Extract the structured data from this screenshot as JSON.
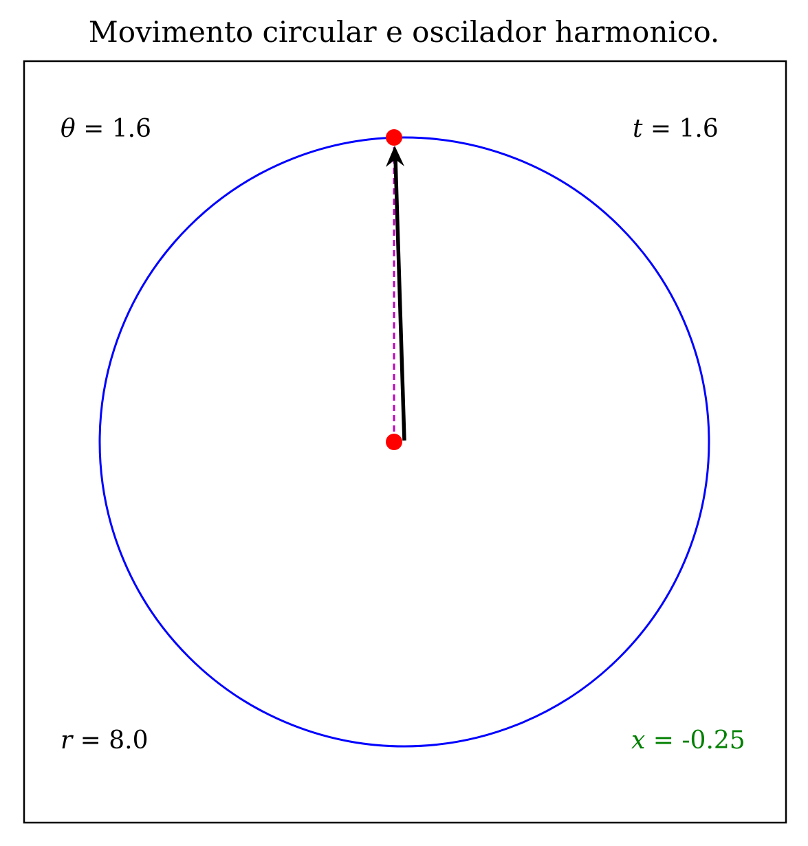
{
  "title": "Movimento circular e oscilador harmonico.",
  "annotations": {
    "theta": {
      "symbol": "θ",
      "value": "1.6"
    },
    "time": {
      "symbol": "t",
      "value": "1.6"
    },
    "radius": {
      "symbol": "r",
      "value": "8.0"
    },
    "x": {
      "symbol": "x",
      "value": "-0.25"
    }
  },
  "colors": {
    "circle": "#0000ff",
    "point": "#ff0000",
    "arrow": "#000000",
    "projection": "#bf00bf",
    "x_label": "#008000",
    "frame": "#000000"
  },
  "icons": {
    "center_point": "red-dot",
    "tip_point": "red-dot",
    "vector": "arrow"
  }
}
